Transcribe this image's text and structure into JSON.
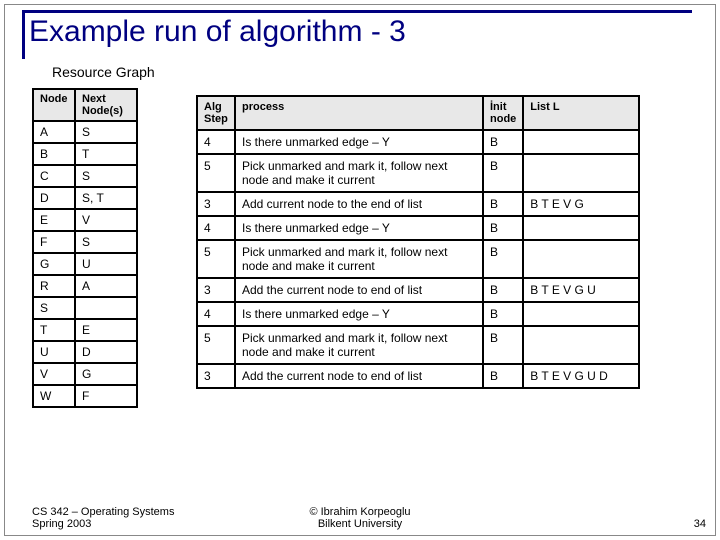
{
  "title": "Example run of algorithm - 3",
  "subtitle": "Resource Graph",
  "left_table": {
    "headers": {
      "node": "Node",
      "next": "Next Node(s)"
    },
    "rows": [
      {
        "node": "A",
        "next": "S"
      },
      {
        "node": "B",
        "next": "T"
      },
      {
        "node": "C",
        "next": "S"
      },
      {
        "node": "D",
        "next": "S, T"
      },
      {
        "node": "E",
        "next": "V"
      },
      {
        "node": "F",
        "next": "S"
      },
      {
        "node": "G",
        "next": "U"
      },
      {
        "node": "R",
        "next": "A"
      },
      {
        "node": "S",
        "next": ""
      },
      {
        "node": "T",
        "next": "E"
      },
      {
        "node": "U",
        "next": "D"
      },
      {
        "node": "V",
        "next": "G"
      },
      {
        "node": "W",
        "next": "F"
      }
    ]
  },
  "right_table": {
    "headers": {
      "step": "Alg Step",
      "process": "process",
      "init": "İnit node",
      "list": "List L"
    },
    "rows": [
      {
        "step": "4",
        "process": "Is there  unmarked edge – Y",
        "init": "B",
        "list": ""
      },
      {
        "step": "5",
        "process": "Pick unmarked and mark it, follow next node and make it current",
        "init": "B",
        "list": ""
      },
      {
        "step": "3",
        "process": "Add current node to the end of  list",
        "init": "B",
        "list": "B T E V G"
      },
      {
        "step": "4",
        "process": "Is there  unmarked edge – Y",
        "init": "B",
        "list": ""
      },
      {
        "step": "5",
        "process": "Pick unmarked and mark it, follow next node and make it current",
        "init": "B",
        "list": ""
      },
      {
        "step": "3",
        "process": "Add the current node to end of  list",
        "init": "B",
        "list": "B T E V G U"
      },
      {
        "step": "4",
        "process": "Is there  unmarked edge – Y",
        "init": "B",
        "list": ""
      },
      {
        "step": "5",
        "process": "Pick unmarked and mark it, follow next node and make it current",
        "init": "B",
        "list": ""
      },
      {
        "step": "3",
        "process": "Add the current node to end of  list",
        "init": "B",
        "list": "B T E V G U D"
      }
    ]
  },
  "footer": {
    "left_line1": "CS 342 – Operating Systems",
    "left_line2": "Spring 2003",
    "center_line1": "© Ibrahim Korpeoglu",
    "center_line2": "Bilkent University",
    "page": "34"
  }
}
